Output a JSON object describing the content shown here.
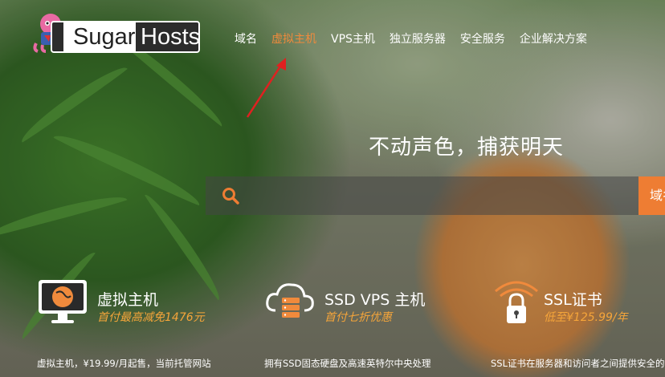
{
  "brand": {
    "sugar": "Sugar",
    "hosts": "Hosts"
  },
  "nav": {
    "items": [
      {
        "label": "域名"
      },
      {
        "label": "虚拟主机"
      },
      {
        "label": "VPS主机"
      },
      {
        "label": "独立服务器"
      },
      {
        "label": "安全服务"
      },
      {
        "label": "企业解决方案"
      }
    ],
    "active_index": 1
  },
  "hero": {
    "headline": "不动声色，捕获明天"
  },
  "search": {
    "placeholder": "",
    "button_label": "域名"
  },
  "features": [
    {
      "title": "虚拟主机",
      "subtitle": "首付最高减免1476元",
      "description": "虚拟主机，¥19.99/月起售，当前托管网站",
      "icon": "monitor-icon"
    },
    {
      "title": "SSD VPS 主机",
      "subtitle": "首付七折优惠",
      "description": "拥有SSD固态硬盘及高速英特尔中央处理",
      "icon": "cloud-server-icon"
    },
    {
      "title": "SSL证书",
      "subtitle": "低至¥125.99/年",
      "description": "SSL证书在服务器和访问者之间提供安全的",
      "icon": "lock-icon"
    }
  ],
  "colors": {
    "accent": "#ee7d33",
    "active_nav": "#f08a3c",
    "subtitle": "#f5a53a"
  }
}
